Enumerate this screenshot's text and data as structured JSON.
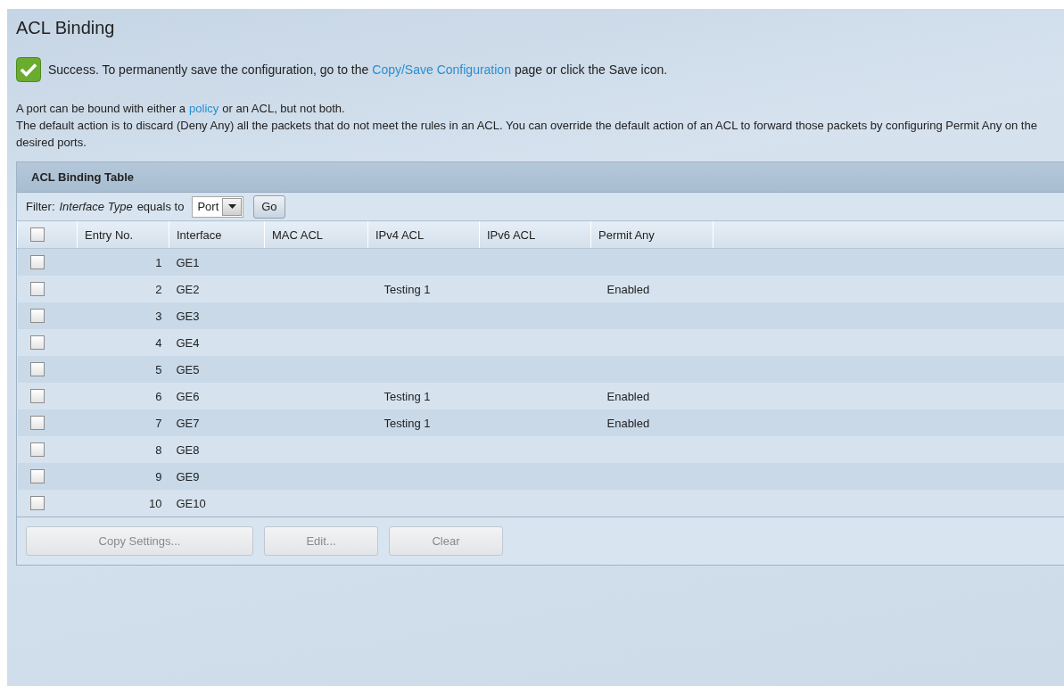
{
  "page": {
    "title": "ACL Binding"
  },
  "notice": {
    "kind": "success",
    "text_before": "Success. To permanently save the configuration, go to the",
    "link": "Copy/Save Configuration",
    "text_after": "page or click the Save icon."
  },
  "intro": [
    {
      "text_before": "A port can be bound with either a",
      "link": "policy",
      "text_after": "or an ACL, but not both."
    },
    {
      "text_before": "The default action is to discard (Deny Any) all the packets that do not meet the rules in an ACL. You can override the default action of an ACL to forward those packets by configuring Permit Any on the desired ports."
    }
  ],
  "table": {
    "title": "ACL Binding Table",
    "filter": {
      "label": "Filter:",
      "field": "Interface Type",
      "operator": "equals to",
      "value": "Port",
      "button": "Go"
    },
    "select_all": {
      "checked": false
    },
    "columns": [
      "Entry No.",
      "Interface",
      "MAC ACL",
      "IPv4 ACL",
      "IPv6 ACL",
      "Permit Any"
    ],
    "rows": [
      {
        "checked": false,
        "cells": [
          "1",
          "GE1",
          "",
          "",
          "",
          ""
        ]
      },
      {
        "checked": false,
        "cells": [
          "2",
          "GE2",
          "",
          "Testing 1",
          "",
          "Enabled"
        ]
      },
      {
        "checked": false,
        "cells": [
          "3",
          "GE3",
          "",
          "",
          "",
          ""
        ]
      },
      {
        "checked": false,
        "cells": [
          "4",
          "GE4",
          "",
          "",
          "",
          ""
        ]
      },
      {
        "checked": false,
        "cells": [
          "5",
          "GE5",
          "",
          "",
          "",
          ""
        ]
      },
      {
        "checked": false,
        "cells": [
          "6",
          "GE6",
          "",
          "Testing 1",
          "",
          "Enabled"
        ]
      },
      {
        "checked": false,
        "cells": [
          "7",
          "GE7",
          "",
          "Testing 1",
          "",
          "Enabled"
        ]
      },
      {
        "checked": false,
        "cells": [
          "8",
          "GE8",
          "",
          "",
          "",
          ""
        ]
      },
      {
        "checked": false,
        "cells": [
          "9",
          "GE9",
          "",
          "",
          "",
          ""
        ]
      },
      {
        "checked": false,
        "cells": [
          "10",
          "GE10",
          "",
          "",
          "",
          ""
        ]
      }
    ],
    "buttons": [
      {
        "label": "Copy Settings...",
        "disabled": true
      },
      {
        "label": "Edit...",
        "disabled": true
      },
      {
        "label": "Clear",
        "disabled": true
      }
    ]
  }
}
